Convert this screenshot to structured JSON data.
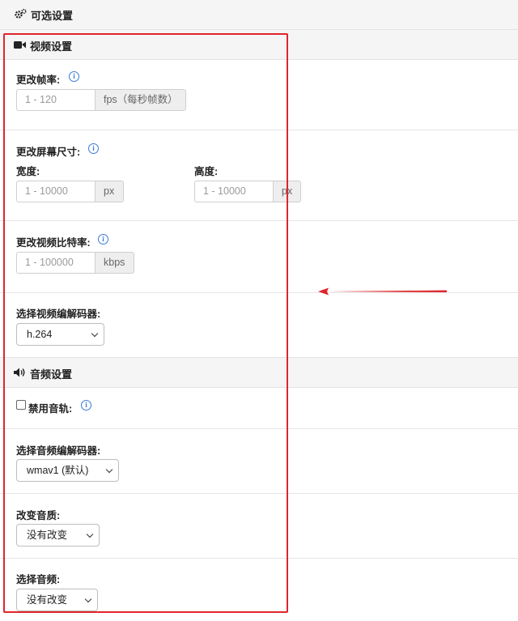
{
  "optional_settings": {
    "title": "可选设置",
    "icon": "gears-icon"
  },
  "video_settings": {
    "title": "视频设置",
    "icon": "video-camera-icon",
    "fps": {
      "label": "更改帧率:",
      "placeholder": "1 - 120",
      "unit": "fps（每秒帧数）"
    },
    "screen_size": {
      "label": "更改屏幕尺寸:",
      "width_label": "宽度:",
      "width_placeholder": "1 - 10000",
      "width_unit": "px",
      "height_label": "高度:",
      "height_placeholder": "1 - 10000",
      "height_unit": "px"
    },
    "bitrate": {
      "label": "更改视频比特率:",
      "placeholder": "1 - 100000",
      "unit": "kbps"
    },
    "codec": {
      "label": "选择视频编解码器:",
      "selected": "h.264"
    }
  },
  "audio_settings": {
    "title": "音频设置",
    "icon": "volume-icon",
    "disable_track": {
      "label": "禁用音轨:",
      "checked": false
    },
    "codec": {
      "label": "选择音频编解码器:",
      "selected": "wmav1 (默认)"
    },
    "quality": {
      "label": "改变音质:",
      "selected": "没有改变"
    },
    "channel": {
      "label": "选择音频:",
      "selected": "没有改变"
    }
  },
  "colors": {
    "annotation": "#e0252b",
    "info": "#3a7bd5"
  }
}
